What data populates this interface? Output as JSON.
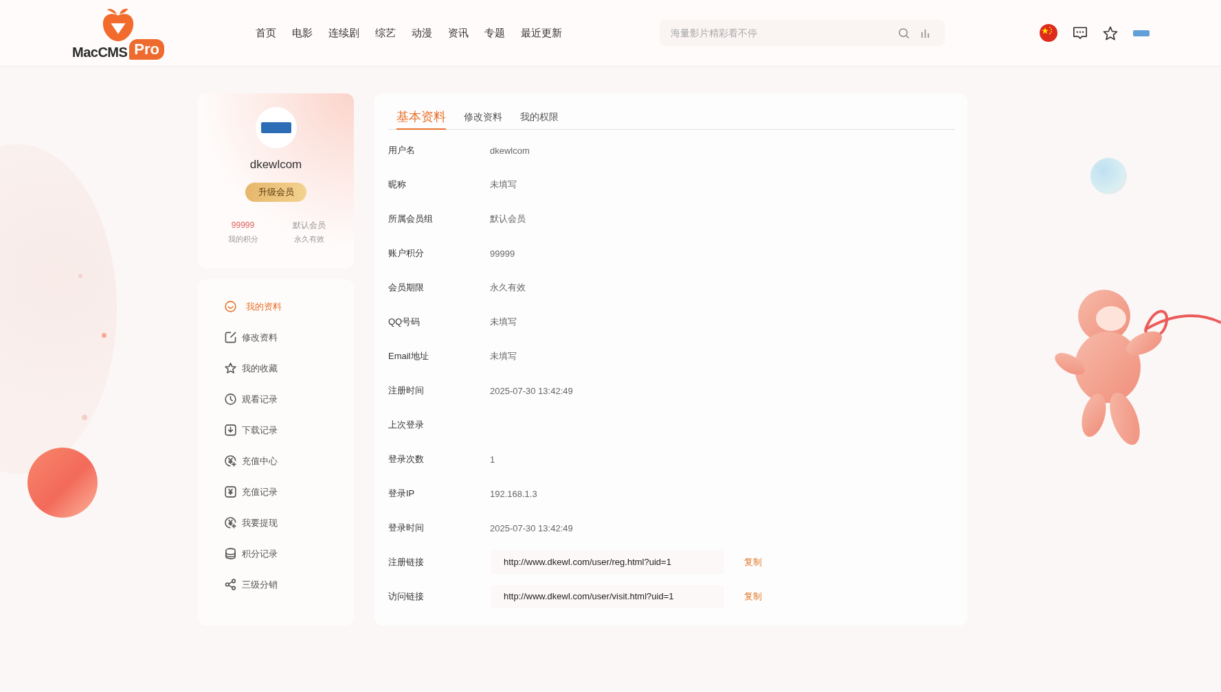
{
  "header": {
    "logo": {
      "text": "MacCMS",
      "badge": "Pro"
    },
    "nav": [
      {
        "label": "首页",
        "selected": false
      },
      {
        "label": "电影",
        "selected": false
      },
      {
        "label": "连续剧",
        "selected": false
      },
      {
        "label": "综艺",
        "selected": false
      },
      {
        "label": "动漫",
        "selected": false
      },
      {
        "label": "资讯",
        "selected": false
      },
      {
        "label": "专题",
        "selected": false
      },
      {
        "label": "最近更新",
        "selected": false
      }
    ],
    "search": {
      "placeholder": "海量影片精彩看不停"
    }
  },
  "profile": {
    "username": "dkewlcom",
    "upgrade_button": "升级会员",
    "stats": [
      {
        "kind": "points",
        "value": "99999",
        "label": "我的积分"
      },
      {
        "kind": "group",
        "value": "默认会员",
        "label": "永久有效"
      }
    ]
  },
  "sidebar": {
    "items": [
      {
        "label": "我的资料",
        "selected": true
      },
      {
        "label": "修改资料",
        "selected": false
      },
      {
        "label": "我的收藏",
        "selected": false
      },
      {
        "label": "观看记录",
        "selected": false
      },
      {
        "label": "下载记录",
        "selected": false
      },
      {
        "label": "充值中心",
        "selected": false
      },
      {
        "label": "充值记录",
        "selected": false
      },
      {
        "label": "我要提现",
        "selected": false
      },
      {
        "label": "积分记录",
        "selected": false
      },
      {
        "label": "三级分销",
        "selected": false
      }
    ]
  },
  "tabs": [
    {
      "label": "基本资料",
      "selected": true
    },
    {
      "label": "修改资料",
      "selected": false
    },
    {
      "label": "我的权限",
      "selected": false
    }
  ],
  "fields": [
    {
      "kind": "text",
      "label": "用户名",
      "value": "dkewlcom"
    },
    {
      "kind": "text",
      "label": "昵称",
      "value": "未填写"
    },
    {
      "kind": "text",
      "label": "所属会员组",
      "value": "默认会员"
    },
    {
      "kind": "text",
      "label": "账户积分",
      "value": "99999"
    },
    {
      "kind": "text",
      "label": "会员期限",
      "value": "永久有效"
    },
    {
      "kind": "text",
      "label": "QQ号码",
      "value": "未填写"
    },
    {
      "kind": "text",
      "label": "Email地址",
      "value": "未填写"
    },
    {
      "kind": "text",
      "label": "注册时间",
      "value": "2025-07-30 13:42:49"
    },
    {
      "kind": "text",
      "label": "上次登录"
    },
    {
      "kind": "text",
      "label": "登录次数",
      "value": "1"
    },
    {
      "kind": "text",
      "label": "登录IP",
      "value": "192.168.1.3"
    },
    {
      "kind": "text",
      "label": "登录时间",
      "value": "2025-07-30 13:42:49"
    },
    {
      "kind": "link",
      "label": "注册链接",
      "value": "http://www.dkewl.com/user/reg.html?uid=1",
      "action": "复制"
    },
    {
      "kind": "link",
      "label": "访问链接",
      "value": "http://www.dkewl.com/user/visit.html?uid=1",
      "action": "复制"
    }
  ]
}
